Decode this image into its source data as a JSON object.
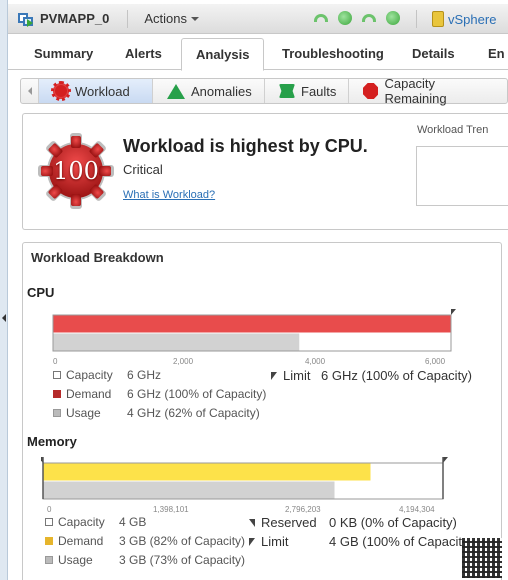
{
  "window": {
    "object_name": "PVMAPP_0",
    "actions_label": "Actions",
    "status_icons": [
      "alarm-arc-icon",
      "ok-dot-icon",
      "alarm-arc-icon",
      "ok-dot-icon"
    ],
    "vsphere_label": "vSphere"
  },
  "tabs": [
    {
      "label": "Summary",
      "active": false
    },
    {
      "label": "Alerts",
      "active": false
    },
    {
      "label": "Analysis",
      "active": true
    },
    {
      "label": "Troubleshooting",
      "active": false
    },
    {
      "label": "Details",
      "active": false
    },
    {
      "label": "En",
      "active": false
    }
  ],
  "subtabs": [
    {
      "label": "Workload",
      "icon": "workload-gear-icon",
      "active": true
    },
    {
      "label": "Anomalies",
      "icon": "anomalies-triangle-icon",
      "active": false
    },
    {
      "label": "Faults",
      "icon": "faults-icon",
      "active": false
    },
    {
      "label": "Capacity Remaining",
      "icon": "capacity-hexagon-icon",
      "active": false
    }
  ],
  "summary": {
    "score": "100",
    "headline": "Workload is highest by CPU.",
    "severity": "Critical",
    "help_link": "What is Workload?",
    "trend_title": "Workload Tren"
  },
  "breakdown": {
    "title": "Workload Breakdown"
  },
  "colors": {
    "cpu_demand": "#e84c4c",
    "usage": "#d2d2d2",
    "mem_demand": "#fde24a",
    "link": "#2a6fb5"
  },
  "chart_data": [
    {
      "type": "bar",
      "title": "CPU",
      "unit": "MHz",
      "xlim": [
        0,
        6000
      ],
      "ticks": [
        "0",
        "2,000",
        "4,000",
        "6,000"
      ],
      "tick_values": [
        0,
        2000,
        4000,
        6000
      ],
      "series": [
        {
          "name": "Demand",
          "value": 6000,
          "color": "#e84c4c"
        },
        {
          "name": "Usage",
          "value": 3720,
          "color": "#d2d2d2"
        }
      ],
      "markers": [
        {
          "name": "Limit",
          "value": 6000
        }
      ],
      "legend": [
        {
          "key": "capacity",
          "label": "Capacity",
          "value": "6 GHz"
        },
        {
          "key": "demand",
          "label": "Demand",
          "value": "6 GHz (100% of Capacity)"
        },
        {
          "key": "usage",
          "label": "Usage",
          "value": "4 GHz (62% of Capacity)"
        },
        {
          "key": "limit",
          "label": "Limit",
          "value": "6 GHz (100% of Capacity)"
        }
      ]
    },
    {
      "type": "bar",
      "title": "Memory",
      "unit": "KB",
      "xlim": [
        0,
        4194304
      ],
      "ticks": [
        "0",
        "1,398,101",
        "2,796,203",
        "4,194,304"
      ],
      "tick_values": [
        0,
        1398101,
        2796203,
        4194304
      ],
      "series": [
        {
          "name": "Demand",
          "value": 3439329,
          "color": "#fde24a"
        },
        {
          "name": "Usage",
          "value": 3061842,
          "color": "#d2d2d2"
        }
      ],
      "markers": [
        {
          "name": "Reserved",
          "value": 0
        },
        {
          "name": "Limit",
          "value": 4194304
        }
      ],
      "legend": [
        {
          "key": "capacity",
          "label": "Capacity",
          "value": "4 GB"
        },
        {
          "key": "demand",
          "label": "Demand",
          "value": "3 GB (82% of Capacity)"
        },
        {
          "key": "usage",
          "label": "Usage",
          "value": "3 GB (73% of Capacity)"
        },
        {
          "key": "reserved",
          "label": "Reserved",
          "value": "0 KB (0% of Capacity)"
        },
        {
          "key": "limit",
          "label": "Limit",
          "value": "4 GB (100% of Capacit"
        }
      ]
    }
  ]
}
